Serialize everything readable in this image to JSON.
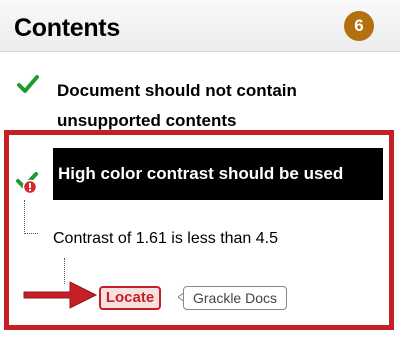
{
  "header": {
    "title": "Contents",
    "count": "6",
    "count_color": "#b3700f"
  },
  "items": [
    {
      "text": "Document should not contain unsupported contents",
      "status": "passed",
      "icon": "check-icon"
    },
    {
      "text": "High color contrast should be used",
      "status": "failed",
      "icon": "check-with-error-icon",
      "detail": "Contrast of 1.61 is less than 4.5",
      "actions": {
        "locate_label": "Locate",
        "docs_label": "Grackle Docs"
      }
    }
  ],
  "colors": {
    "highlight_border": "#c62026",
    "check_green": "#1e9a2f",
    "error_red": "#d9262c",
    "banner_bg": "#000000"
  }
}
